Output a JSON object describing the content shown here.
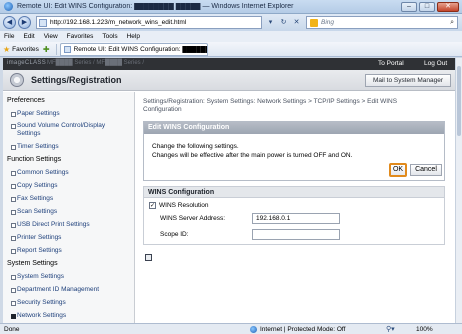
{
  "window": {
    "title": "Remote UI: Edit WINS Configuration: ████████ █████ — Windows Internet Explorer",
    "minimize": "–",
    "maximize": "□",
    "close": "✕"
  },
  "address": {
    "url": "http://192.168.1.223/m_network_wins_edit.html",
    "search_placeholder": "Bing"
  },
  "menu": [
    "File",
    "Edit",
    "View",
    "Favorites",
    "Tools",
    "Help"
  ],
  "favorites": {
    "label": "Favorites",
    "tab_title": "Remote UI: Edit WINS Configuration: ██████ ███..."
  },
  "header": {
    "brand": "imageCLASS",
    "model": "MF████ Series / MF████ Series /",
    "to_portal": "To Portal",
    "logout": "Log Out",
    "section_title": "Settings/Registration",
    "mail_button": "Mail to System Manager"
  },
  "sidebar": {
    "categories": [
      "Preferences",
      "Function Settings",
      "System Settings"
    ],
    "items": [
      {
        "label": "Paper Settings"
      },
      {
        "label": "Sound Volume Control/Display Settings"
      },
      {
        "label": "Timer Settings"
      },
      {
        "label": "Common Settings"
      },
      {
        "label": "Copy Settings"
      },
      {
        "label": "Fax Settings"
      },
      {
        "label": "Scan Settings"
      },
      {
        "label": "USB Direct Print Settings"
      },
      {
        "label": "Printer Settings"
      },
      {
        "label": "Report Settings"
      },
      {
        "label": "System Settings"
      },
      {
        "label": "Department ID Management"
      },
      {
        "label": "Security Settings"
      },
      {
        "label": "Network Settings"
      }
    ]
  },
  "main": {
    "breadcrumb": "Settings/Registration: System Settings: Network Settings > TCP/IP Settings > Edit WINS Configuration",
    "edit_box": {
      "title": "Edit WINS Configuration",
      "message_line1": "Change the following settings.",
      "message_line2": "Changes will be effective after the main power is turned OFF and ON.",
      "ok": "OK",
      "cancel": "Cancel"
    },
    "wins": {
      "title": "WINS Configuration",
      "resolution_label": "WINS Resolution",
      "resolution_checked": "✓",
      "server_address_label": "WINS Server Address:",
      "server_address_value": "192.168.0.1",
      "scope_id_label": "Scope ID:",
      "scope_id_value": ""
    }
  },
  "status": {
    "left": "Done",
    "zone": "Internet | Protected Mode: Off",
    "zoom": "100%"
  },
  "colors": {
    "ok_highlight": "#e18a1c",
    "dark_header": "#2f3135"
  }
}
